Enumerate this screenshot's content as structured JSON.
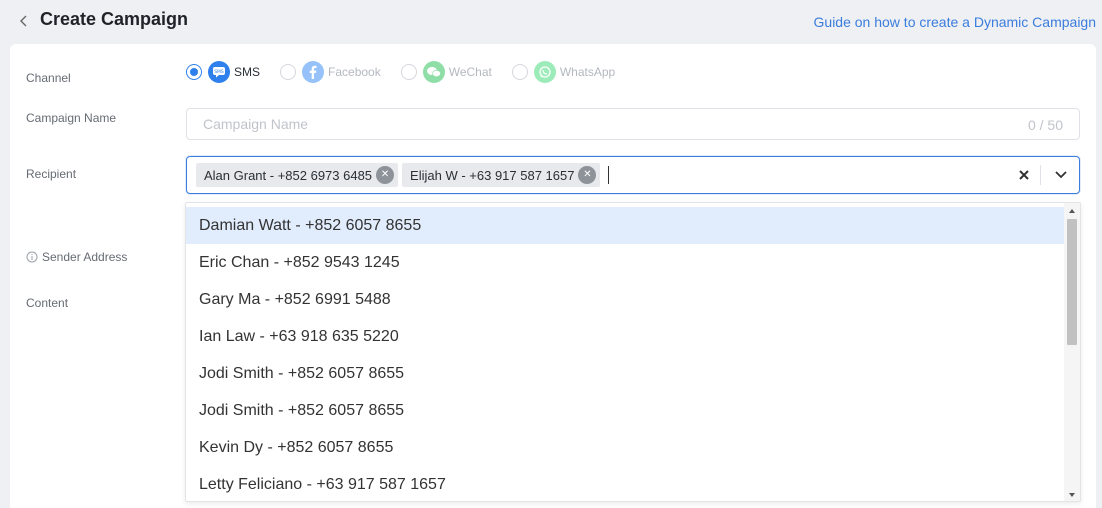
{
  "header": {
    "title": "Create Campaign",
    "guide_link": "Guide on how to create a Dynamic Campaign"
  },
  "form": {
    "labels": {
      "channel": "Channel",
      "campaign_name": "Campaign Name",
      "recipient": "Recipient",
      "sender_address": "Sender Address",
      "content": "Content"
    },
    "channels": [
      {
        "label": "SMS",
        "icon": "sms-icon",
        "selected": true,
        "color": "#2f80ed"
      },
      {
        "label": "Facebook",
        "icon": "facebook-icon",
        "selected": false,
        "color": "#1877f2"
      },
      {
        "label": "WeChat",
        "icon": "wechat-icon",
        "selected": false,
        "color": "#09b83e"
      },
      {
        "label": "WhatsApp",
        "icon": "whatsapp-icon",
        "selected": false,
        "color": "#25d366"
      }
    ],
    "campaign_name": {
      "value": "",
      "placeholder": "Campaign Name",
      "counter": "0 / 50"
    },
    "recipient": {
      "selected": [
        {
          "label": "Alan Grant - +852 6973 6485"
        },
        {
          "label": "Elijah W - +63 917 587 1657"
        }
      ]
    }
  },
  "dropdown": {
    "options": [
      {
        "label": "Damian Watt - +852 6057 8655",
        "active": true
      },
      {
        "label": "Eric Chan - +852 9543 1245"
      },
      {
        "label": "Gary Ma - +852 6991 5488"
      },
      {
        "label": "Ian Law - +63 918 635 5220"
      },
      {
        "label": "Jodi Smith - +852 6057 8655"
      },
      {
        "label": "Jodi Smith - +852 6057 8655"
      },
      {
        "label": "Kevin Dy - +852 6057 8655"
      },
      {
        "label": "Letty Feliciano - +63 917 587 1657"
      }
    ]
  },
  "colors": {
    "accent": "#3b7ddd",
    "active_option_bg": "#e1edfd",
    "page_bg": "#eef0f3"
  }
}
